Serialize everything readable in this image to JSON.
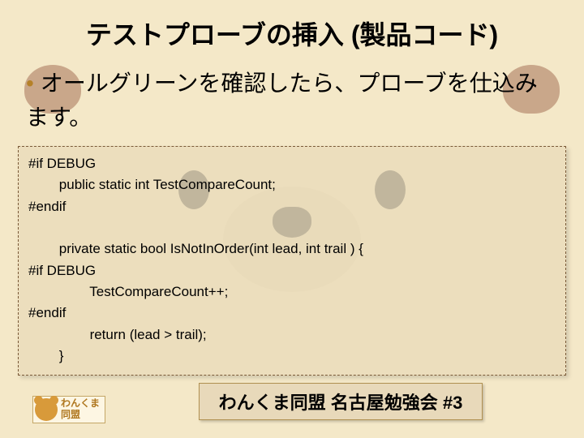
{
  "title": "テストプローブの挿入 (製品コード)",
  "bullet": {
    "marker": "•",
    "text": "オールグリーンを確認したら、プローブを仕込みます。"
  },
  "code": {
    "line1": "#if DEBUG",
    "line2": "        public static int TestCompareCount;",
    "line3": "#endif",
    "line4": "",
    "line5": "        private static bool IsNotInOrder(int lead, int trail ) {",
    "line6": "#if DEBUG",
    "line7": "                TestCompareCount++;",
    "line8": "#endif",
    "line9": "                return (lead > trail);",
    "line10": "        }"
  },
  "footer": {
    "logo_line1": "わんくま",
    "logo_line2": "同盟",
    "text": "わんくま同盟 名古屋勉強会 #3"
  }
}
